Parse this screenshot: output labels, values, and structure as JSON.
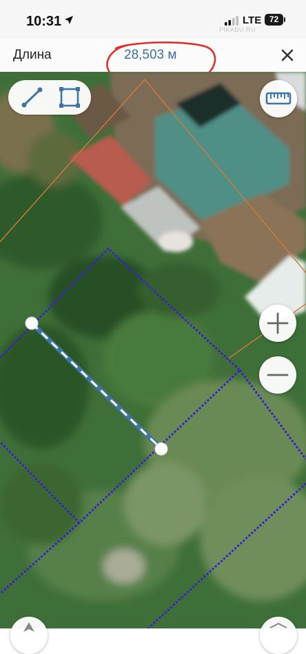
{
  "status_bar": {
    "time": "10:31",
    "network": "LTE",
    "battery": "72",
    "watermark": "PIKABU.RU"
  },
  "header": {
    "title": "Длина",
    "measured_length": "28,503 м"
  },
  "icons": {
    "close": "close-icon",
    "line_mode": "line-tool-icon",
    "area_mode": "area-tool-icon",
    "ruler": "ruler-icon",
    "zoom_in": "plus-icon",
    "zoom_out": "minus-icon"
  },
  "colors": {
    "measure_line": "#3f74a6",
    "parcel_boundary": "#3a1fd0",
    "annotation": "#e0302a",
    "accent_text": "#3a6fa0"
  }
}
